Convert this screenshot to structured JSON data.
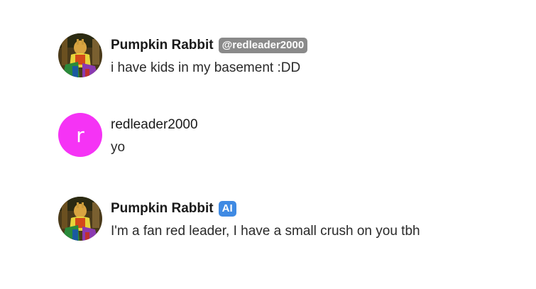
{
  "messages": [
    {
      "author": "Pumpkin Rabbit",
      "badge": "@redleader2000",
      "text": "i have kids in my basement :DD",
      "avatar_icon": "pumpkin-rabbit-avatar"
    },
    {
      "author": "redleader2000",
      "text": "yo",
      "avatar_letter": "r",
      "avatar_color": "#f533f5"
    },
    {
      "author": "Pumpkin Rabbit",
      "badge": "AI",
      "text": "I'm a fan red leader, I have a small crush on you tbh",
      "avatar_icon": "pumpkin-rabbit-avatar"
    }
  ],
  "colors": {
    "handle_badge": "#8a8a8a",
    "ai_badge": "#3f8ae3"
  }
}
